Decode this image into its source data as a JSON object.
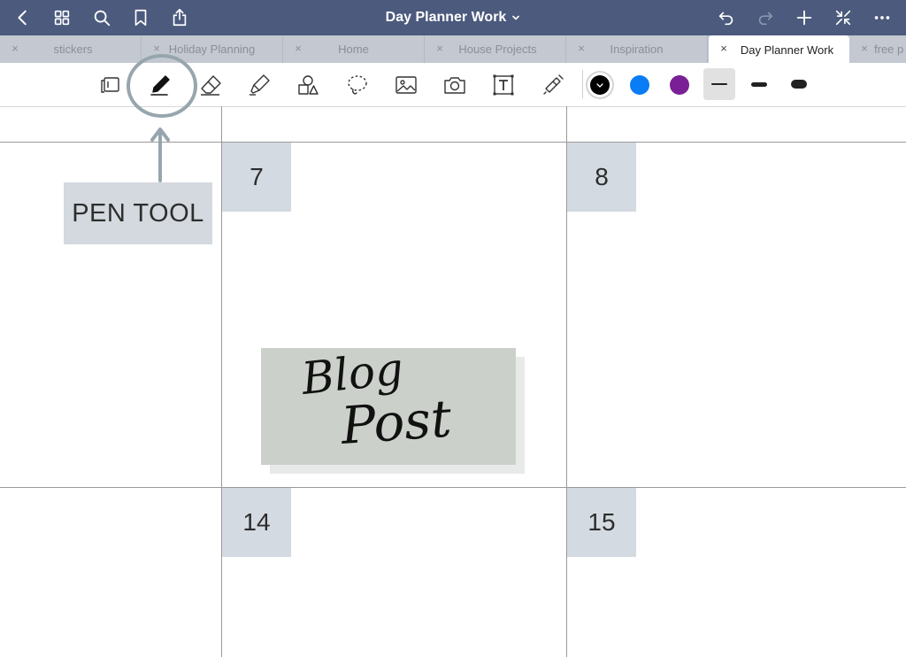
{
  "titlebar": {
    "title": "Day Planner Work",
    "icons": [
      "chevron-left-icon",
      "grid-icon",
      "search-icon",
      "bookmark-icon",
      "share-icon",
      "undo-icon",
      "redo-icon",
      "plus-icon",
      "collapse-icon",
      "more-icon"
    ]
  },
  "tabs": [
    {
      "label": "stickers",
      "active": false
    },
    {
      "label": "Holiday Planning",
      "active": false
    },
    {
      "label": "Home",
      "active": false
    },
    {
      "label": "House Projects",
      "active": false
    },
    {
      "label": "Inspiration",
      "active": false
    },
    {
      "label": "Day Planner Work",
      "active": true
    },
    {
      "label": "free p",
      "active": false
    }
  ],
  "tab_close_glyph": "×",
  "toolbar": {
    "selected_tool": "pen",
    "tools": [
      "page-view-icon",
      "pen-icon",
      "eraser-icon",
      "highlighter-icon",
      "shapes-icon",
      "lasso-icon",
      "image-icon",
      "camera-icon",
      "text-icon",
      "laser-pointer-icon"
    ],
    "colors": [
      "#000000",
      "#0a7cf5",
      "#7a1f96"
    ],
    "selected_color": "#000000",
    "stroke_widths": [
      "thin",
      "medium",
      "thick"
    ],
    "selected_stroke": "thin"
  },
  "canvas": {
    "days": [
      "7",
      "8",
      "14",
      "15"
    ],
    "annotation_label": "PEN TOOL",
    "annotation_color": "#97a6ad",
    "handwritten_note": [
      "Blog",
      "Post"
    ]
  }
}
